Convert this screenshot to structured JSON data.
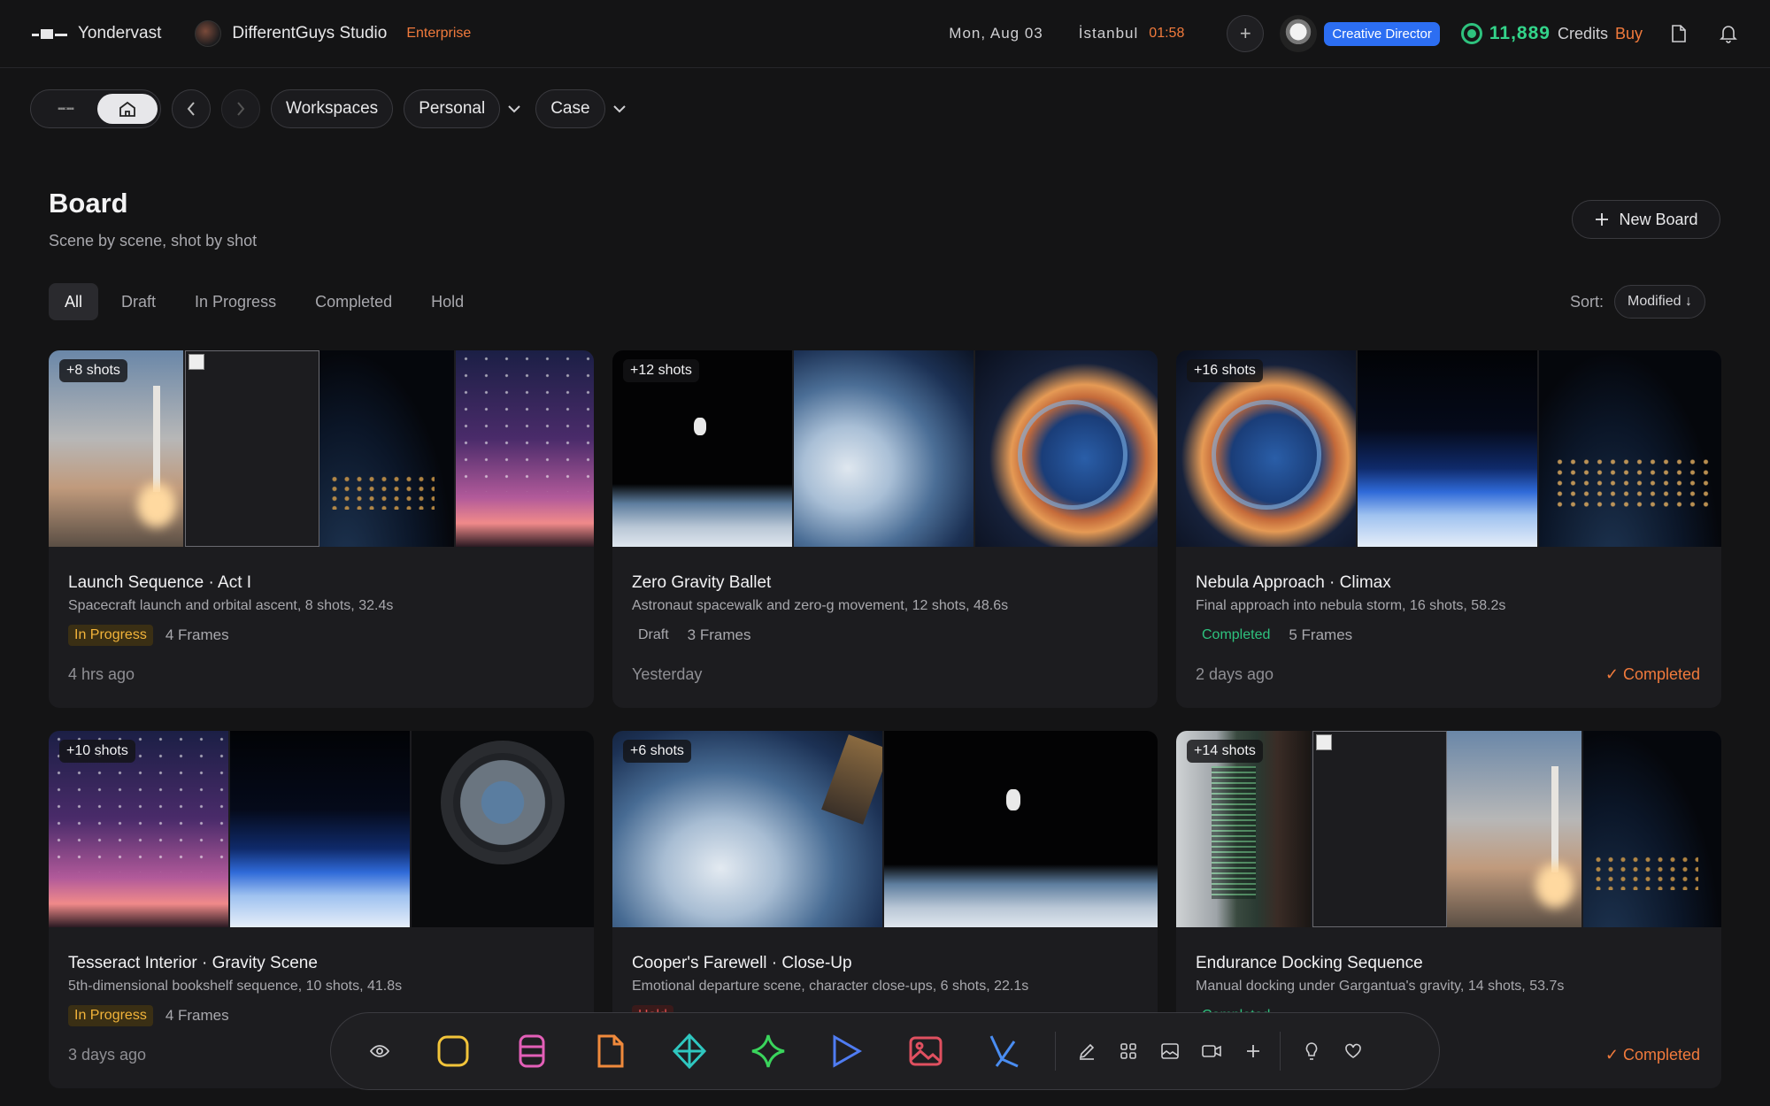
{
  "topbar": {
    "brand": "Yondervast",
    "studio": "DifferentGuys Studio",
    "plan": "Enterprise",
    "date": "Mon, Aug 03",
    "city": "İstanbul",
    "time": "01:58",
    "role": "Creative Director",
    "credits": "11,889",
    "credits_label": "Credits",
    "buy": "Buy"
  },
  "nav": {
    "logo_text": "▪▪▪▫▪▪▪",
    "crumbs": [
      "Workspaces",
      "Personal",
      "Case"
    ]
  },
  "page": {
    "title": "Board",
    "subtitle": "Scene by scene, shot by shot",
    "new_board": "New Board",
    "filters": [
      "All",
      "Draft",
      "In Progress",
      "Completed",
      "Hold"
    ],
    "sort_label": "Sort:",
    "sort_value": "Modified ↓"
  },
  "cards": [
    {
      "badge": "+8 shots",
      "title": "Launch Sequence · Act I",
      "desc": "Spacecraft launch and orbital ascent, 8 shots, 32.4s",
      "status": "In Progress",
      "frames": "4 Frames",
      "ago": "4 hrs ago",
      "check": ""
    },
    {
      "badge": "+12 shots",
      "title": "Zero Gravity Ballet",
      "desc": "Astronaut spacewalk and zero-g movement, 12 shots, 48.6s",
      "status": "Draft",
      "frames": "3 Frames",
      "ago": "Yesterday",
      "check": ""
    },
    {
      "badge": "+16 shots",
      "title": "Nebula Approach · Climax",
      "desc": "Final approach into nebula storm, 16 shots, 58.2s",
      "status": "Completed",
      "frames": "5 Frames",
      "ago": "2 days ago",
      "check": "✓ Completed"
    },
    {
      "badge": "+10 shots",
      "title": "Tesseract Interior · Gravity Scene",
      "desc": "5th-dimensional bookshelf sequence, 10 shots, 41.8s",
      "status": "In Progress",
      "frames": "4 Frames",
      "ago": "3 days ago",
      "check": ""
    },
    {
      "badge": "+6 shots",
      "title": "Cooper's Farewell · Close-Up",
      "desc": "Emotional departure scene, character close-ups, 6 shots, 22.1s",
      "status": "Hold",
      "frames": "",
      "ago": "",
      "check": ""
    },
    {
      "badge": "+14 shots",
      "title": "Endurance Docking Sequence",
      "desc": "Manual docking under Gargantua's gravity, 14 shots, 53.7s",
      "status": "Completed",
      "frames": "",
      "ago": "",
      "check": "✓ Completed"
    }
  ],
  "colors": {
    "accent": "#f07a3c",
    "credits": "#33d48a",
    "role": "#2c6ef2",
    "progress": "#f2b43a",
    "done": "#2ec27e"
  }
}
